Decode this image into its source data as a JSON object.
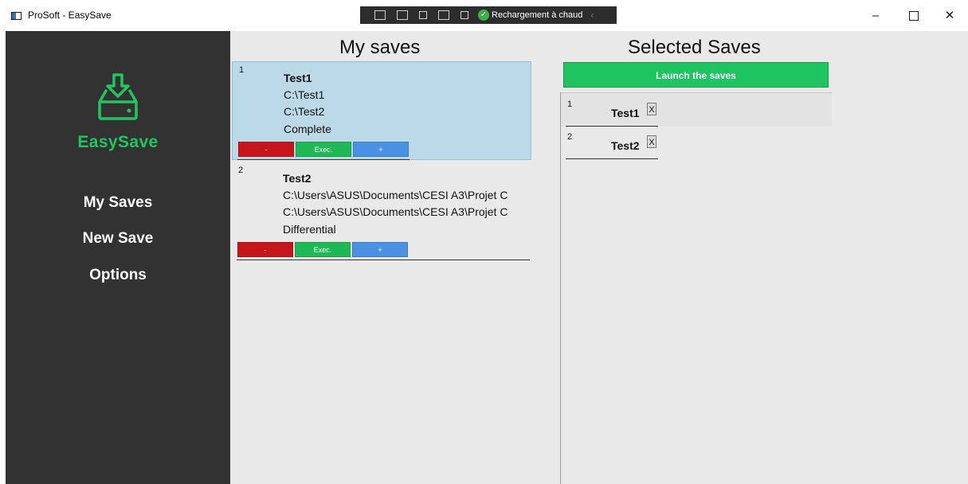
{
  "window": {
    "title": "ProSoft - EasySave",
    "hot_reload_label": "Rechargement à chaud",
    "controls": {
      "minimize": "–",
      "close": "✕"
    }
  },
  "sidebar": {
    "brand": "EasySave",
    "items": [
      {
        "label": "My Saves"
      },
      {
        "label": "New Save"
      },
      {
        "label": "Options"
      }
    ]
  },
  "saves": {
    "heading": "My saves",
    "items": [
      {
        "index": "1",
        "name": "Test1",
        "source": "C:\\Test1",
        "target": "C:\\Test2",
        "type": "Complete"
      },
      {
        "index": "2",
        "name": "Test2",
        "source": "C:\\Users\\ASUS\\Documents\\CESI A3\\Projet C",
        "target": "C:\\Users\\ASUS\\Documents\\CESI A3\\Projet C",
        "type": "Differential"
      }
    ],
    "buttons": {
      "remove": "-",
      "exec": "Exec.",
      "add": "+"
    }
  },
  "selected": {
    "heading": "Selected Saves",
    "launch_label": "Launch the saves",
    "remove_label": "X",
    "items": [
      {
        "index": "1",
        "name": "Test1"
      },
      {
        "index": "2",
        "name": "Test2"
      }
    ]
  },
  "colors": {
    "sidebar_bg": "#323232",
    "brand_green": "#22c55e",
    "selected_card": "#bcd9e7",
    "remove_red": "#c8151b",
    "exec_green": "#1eb955",
    "add_blue": "#4a91e4"
  },
  "icons": {
    "logo": "download-drive-icon",
    "hot_reload": "check-circle-icon"
  }
}
